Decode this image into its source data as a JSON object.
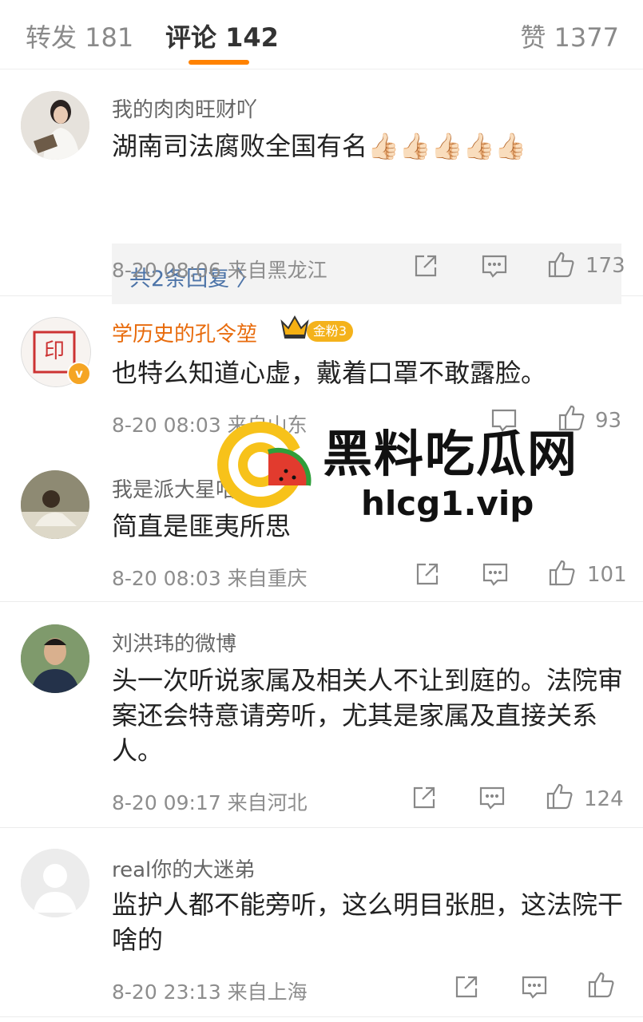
{
  "tabs": {
    "forward": "转发 181",
    "comment": "评论 142",
    "like": "赞 1377"
  },
  "comments": [
    {
      "name": "我的肉肉旺财吖",
      "text": "湖南司法腐败全国有名👍🏻👍🏻👍🏻👍🏻👍🏻",
      "reply": "共2条回复 〉",
      "meta": "8-20 08:06  来自黑龙江",
      "likes": "173"
    },
    {
      "name": "学历史的孔令堃",
      "badge": "金粉3",
      "text": "也特么知道心虚，戴着口罩不敢露脸。",
      "meta": "8-20 08:03  来自山东",
      "likes": "93"
    },
    {
      "name": "我是派大星哈哈哈",
      "text": "简直是匪夷所思",
      "meta": "8-20 08:03  来自重庆",
      "likes": "101"
    },
    {
      "name": "刘洪玮的微博",
      "text": "头一次听说家属及相关人不让到庭的。法院审案还会特意请旁听，尤其是家属及直接关系人。",
      "meta": "8-20 09:17  来自河北",
      "likes": "124"
    },
    {
      "name": "real你的大迷弟",
      "text": "监护人都不能旁听，这么明目张胆，这法院干啥的",
      "meta": "8-20 23:13  来自上海",
      "likes": ""
    }
  ],
  "watermark": {
    "title": "黑料吃瓜网",
    "url": "hlcg1.vip"
  },
  "colors": {
    "accent": "#ff8200",
    "link": "#4d74a8",
    "vip_name": "#e86b0c"
  }
}
